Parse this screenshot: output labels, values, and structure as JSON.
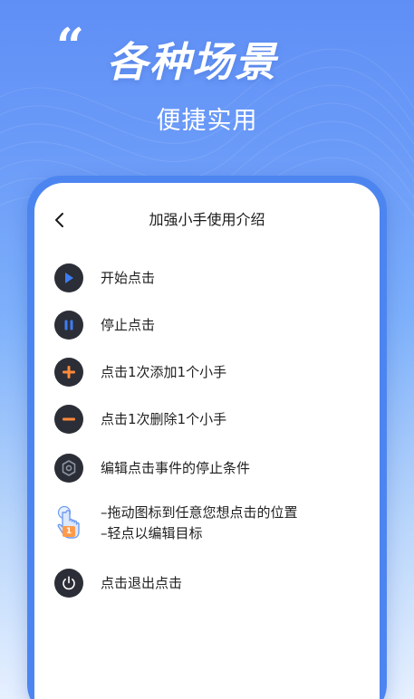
{
  "banner": {
    "quote_mark": "“",
    "headline": "各种场景",
    "subhead": "便捷实用"
  },
  "screen": {
    "title": "加强小手使用介绍",
    "back_icon": "chevron-left-icon",
    "items": [
      {
        "icon": "play-icon",
        "label": "开始点击"
      },
      {
        "icon": "pause-icon",
        "label": "停止点击"
      },
      {
        "icon": "plus-icon",
        "label": "点击1次添加1个小手"
      },
      {
        "icon": "minus-icon",
        "label": "点击1次删除1个小手"
      },
      {
        "icon": "gear-icon",
        "label": "编辑点击事件的停止条件"
      },
      {
        "icon": "hand-pointer-icon",
        "badge": "1",
        "lines": [
          "–拖动图标到任意您想点击的位置",
          "–轻点以编辑目标"
        ]
      },
      {
        "icon": "power-icon",
        "label": "点击退出点击"
      }
    ]
  },
  "colors": {
    "icon_bg": "#2b2e36",
    "play_accent": "#3d7cf5",
    "plus_minus_accent": "#ff8a3a",
    "frame_blue": "#4d85f0"
  }
}
